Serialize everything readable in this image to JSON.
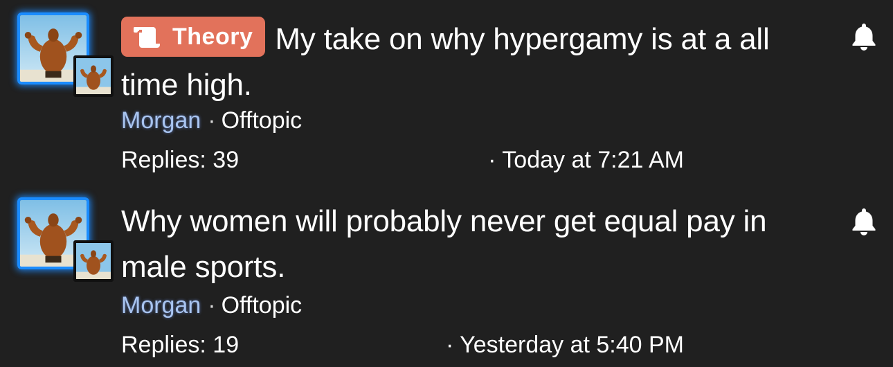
{
  "threads": [
    {
      "prefix": "Theory",
      "prefix_icon": "scroll-icon",
      "prefix_color": "#e2725b",
      "title": "My take on why hypergamy is at a all time high.",
      "author": "Morgan",
      "forum": "Offtopic",
      "replies": "Replies: 39",
      "last_activity": "· Today at 7:21 AM",
      "watch_icon": "bell-icon"
    },
    {
      "prefix": "",
      "title": "Why women will probably never get equal pay in male sports.",
      "author": "Morgan",
      "forum": "Offtopic",
      "replies": "Replies: 19",
      "last_activity": "· Yesterday at 5:40 PM",
      "watch_icon": "bell-icon"
    }
  ],
  "colors": {
    "background": "#202020",
    "avatar_border": "#1a8cff",
    "author_link": "#a8c4f0"
  },
  "separator": "·"
}
